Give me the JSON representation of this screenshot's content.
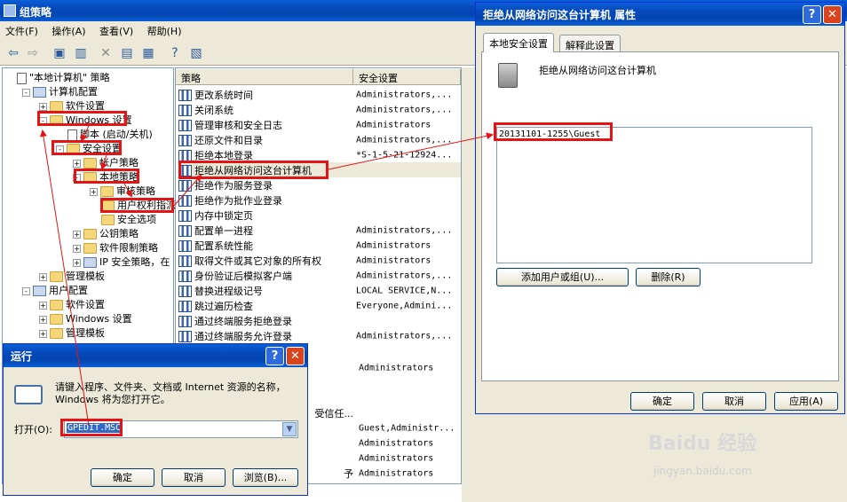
{
  "main_window": {
    "title": "组策略",
    "menu": [
      "文件(F)",
      "操作(A)",
      "查看(V)",
      "帮助(H)"
    ],
    "tree": [
      {
        "label": "\"本地计算机\" 策略",
        "indent": 0,
        "icon": "doc",
        "pm": ""
      },
      {
        "label": "计算机配置",
        "indent": 1,
        "icon": "pc",
        "pm": "-"
      },
      {
        "label": "软件设置",
        "indent": 2,
        "icon": "folder",
        "pm": "+"
      },
      {
        "label": "Windows 设置",
        "indent": 2,
        "icon": "folder",
        "pm": "-"
      },
      {
        "label": "脚本 (启动/关机)",
        "indent": 3,
        "icon": "doc",
        "pm": ""
      },
      {
        "label": "安全设置",
        "indent": 3,
        "icon": "folder",
        "pm": "-"
      },
      {
        "label": "帐户策略",
        "indent": 4,
        "icon": "folder",
        "pm": "+"
      },
      {
        "label": "本地策略",
        "indent": 4,
        "icon": "folder",
        "pm": "-"
      },
      {
        "label": "审核策略",
        "indent": 5,
        "icon": "folder",
        "pm": "+"
      },
      {
        "label": "用户权利指派",
        "indent": 5,
        "icon": "folder",
        "pm": ""
      },
      {
        "label": "安全选项",
        "indent": 5,
        "icon": "folder",
        "pm": ""
      },
      {
        "label": "公钥策略",
        "indent": 4,
        "icon": "folder",
        "pm": "+"
      },
      {
        "label": "软件限制策略",
        "indent": 4,
        "icon": "folder",
        "pm": "+"
      },
      {
        "label": "IP 安全策略，在",
        "indent": 4,
        "icon": "pc",
        "pm": "+"
      },
      {
        "label": "管理模板",
        "indent": 2,
        "icon": "folder",
        "pm": "+"
      },
      {
        "label": "用户配置",
        "indent": 1,
        "icon": "pc",
        "pm": "-"
      },
      {
        "label": "软件设置",
        "indent": 2,
        "icon": "folder",
        "pm": "+"
      },
      {
        "label": "Windows 设置",
        "indent": 2,
        "icon": "folder",
        "pm": "+"
      },
      {
        "label": "管理模板",
        "indent": 2,
        "icon": "folder",
        "pm": "+"
      }
    ],
    "list_headers": [
      "策略",
      "安全设置"
    ],
    "list": [
      {
        "policy": "更改系统时间",
        "setting": "Administrators,..."
      },
      {
        "policy": "关闭系统",
        "setting": "Administrators,..."
      },
      {
        "policy": "管理审核和安全日志",
        "setting": "Administrators"
      },
      {
        "policy": "还原文件和目录",
        "setting": "Administrators,..."
      },
      {
        "policy": "拒绝本地登录",
        "setting": "*S-1-5-21-12924..."
      },
      {
        "policy": "拒绝从网络访问这台计算机",
        "setting": ""
      },
      {
        "policy": "拒绝作为服务登录",
        "setting": ""
      },
      {
        "policy": "拒绝作为批作业登录",
        "setting": ""
      },
      {
        "policy": "内存中锁定页",
        "setting": ""
      },
      {
        "policy": "配置单一进程",
        "setting": "Administrators,..."
      },
      {
        "policy": "配置系统性能",
        "setting": "Administrators"
      },
      {
        "policy": "取得文件或其它对象的所有权",
        "setting": "Administrators"
      },
      {
        "policy": "身份验证后模拟客户端",
        "setting": "Administrators,..."
      },
      {
        "policy": "替换进程级记号",
        "setting": "LOCAL SERVICE,N..."
      },
      {
        "policy": "跳过遍历检查",
        "setting": "Everyone,Admini..."
      },
      {
        "policy": "通过终端服务拒绝登录",
        "setting": ""
      },
      {
        "policy": "通过终端服务允许登录",
        "setting": "Administrators,..."
      }
    ],
    "list_extra": [
      {
        "policy": "",
        "setting": "Administrators"
      },
      {
        "policy": "受信任...",
        "setting": ""
      },
      {
        "policy": "",
        "setting": "Guest,Administr..."
      },
      {
        "policy": "",
        "setting": "Administrators"
      },
      {
        "policy": "",
        "setting": "Administrators"
      },
      {
        "policy": "予",
        "setting": "Administrators"
      }
    ]
  },
  "props_dialog": {
    "title": "拒绝从网络访问这台计算机 属性",
    "tabs": [
      "本地安全设置",
      "解释此设置"
    ],
    "policy_name": "拒绝从网络访问这台计算机",
    "entries": [
      "20131101-1255\\Guest"
    ],
    "add_button": "添加用户或组(U)...",
    "remove_button": "删除(R)",
    "ok": "确定",
    "cancel": "取消",
    "apply": "应用(A)"
  },
  "run_dialog": {
    "title": "运行",
    "prompt": "请键入程序、文件夹、文档或 Internet 资源的名称，Windows 将为您打开它。",
    "open_label": "打开(O):",
    "open_value": "GPEDIT.MSC",
    "ok": "确定",
    "cancel": "取消",
    "browse": "浏览(B)..."
  },
  "watermark": {
    "line1": "Baidu 经验",
    "line2": "jingyan.baidu.com"
  },
  "colors": {
    "accent": "#0548b8",
    "highlight_red": "#e41414",
    "dialog_bg": "#ece9d8"
  }
}
